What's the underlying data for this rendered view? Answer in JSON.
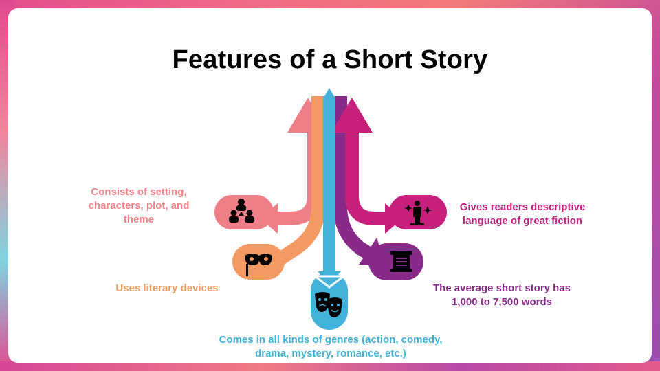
{
  "title": "Features of a Short Story",
  "items": [
    {
      "label": "Consists of setting, characters, plot, and theme",
      "color": "#ee7f88",
      "icon": "team-icon"
    },
    {
      "label": "Uses literary devices",
      "color": "#f39a62",
      "icon": "mask-icon"
    },
    {
      "label": "Comes in all kinds of genres (action, comedy, drama, mystery, romance, etc.)",
      "color": "#43b2db",
      "icon": "theater-masks-icon"
    },
    {
      "label": "The average short story has 1,000 to 7,500 words",
      "color": "#8a2a88",
      "icon": "scroll-icon"
    },
    {
      "label": "Gives readers descriptive language of great fiction",
      "color": "#c61f7c",
      "icon": "magic-figure-icon"
    }
  ]
}
